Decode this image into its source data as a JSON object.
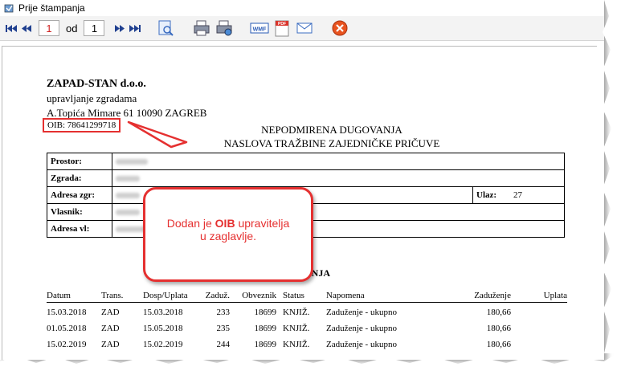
{
  "window": {
    "title": "Prije štampanja"
  },
  "toolbar": {
    "current_page": "1",
    "of_label": "od",
    "total_pages": "1"
  },
  "company": {
    "name": "ZAPAD-STAN d.o.o.",
    "line2": "upravljanje zgradama",
    "address": "A.Topića Mimare 61 10090 ZAGREB",
    "oib": "OIB: 78641299718"
  },
  "doc_title": {
    "line1": "NEPODMIRENA DUGOVANJA",
    "line2": "NASLOVA TRAŽBINE ZAJEDNIČKE PRIČUVE"
  },
  "info": {
    "labels": [
      "Prostor:",
      "Zgrada:",
      "Adresa zgr:",
      "Vlasnik:",
      "Adresa vl:"
    ],
    "ulaz_label": "Ulaz:",
    "ulaz_value": "27"
  },
  "callout": {
    "part1": "Dodan je ",
    "bold": "OIB",
    "part2": " upravitelja",
    "line2": "u zaglavlje."
  },
  "ledger": {
    "section_title": "KNJIŽENJA",
    "headers": [
      "Datum",
      "Trans.",
      "Dosp/Uplata",
      "Zaduž.",
      "Obveznik",
      "Status",
      "Napomena",
      "Zaduženje",
      "Uplata"
    ],
    "rows": [
      [
        "15.03.2018",
        "ZAD",
        "15.03.2018",
        "233",
        "18699",
        "KNJIŽ.",
        "Zaduženje - ukupno",
        "180,66",
        ""
      ],
      [
        "01.05.2018",
        "ZAD",
        "15.05.2018",
        "235",
        "18699",
        "KNJIŽ.",
        "Zaduženje - ukupno",
        "180,66",
        ""
      ],
      [
        "15.02.2019",
        "ZAD",
        "15.02.2019",
        "244",
        "18699",
        "KNJIŽ.",
        "Zaduženje - ukupno",
        "180,66",
        ""
      ]
    ]
  },
  "colors": {
    "accent_red": "#e53030",
    "toolbar_bg": "#f3f3f3"
  },
  "icons": [
    "app-icon",
    "first-page-icon",
    "prev-page-icon",
    "next-page-icon",
    "last-page-icon",
    "zoom-icon",
    "print-icon",
    "print-setup-icon",
    "wmf-export-icon",
    "pdf-export-icon",
    "email-icon",
    "close-icon"
  ]
}
